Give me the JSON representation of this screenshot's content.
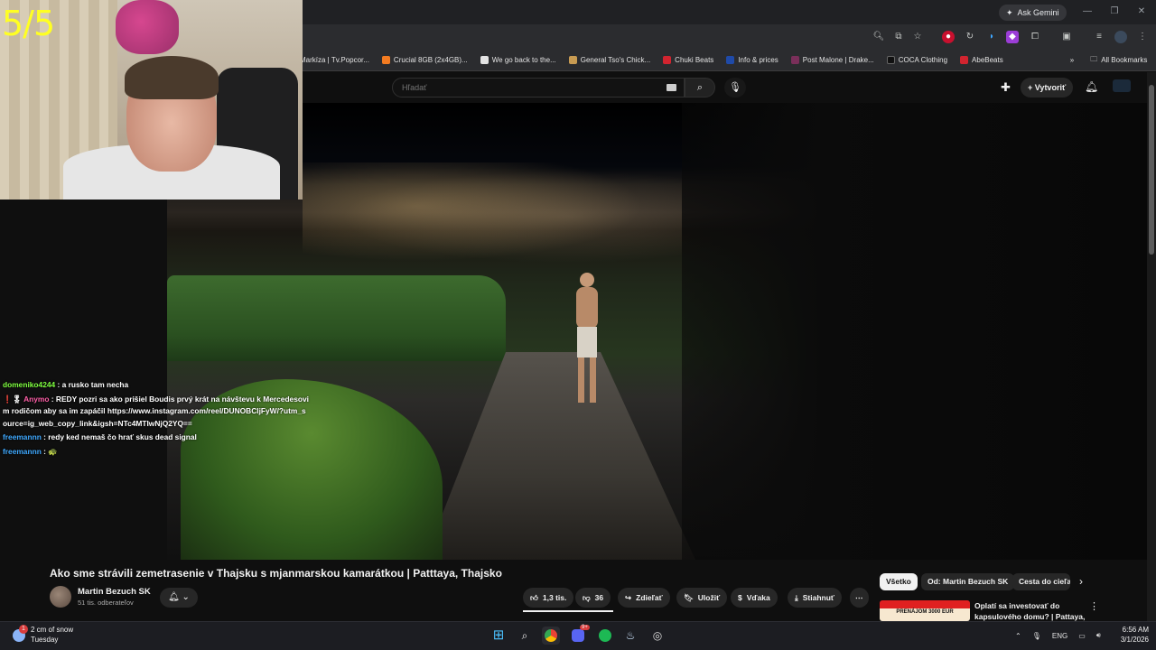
{
  "stream_overlay": {
    "counter": "5/5"
  },
  "browser": {
    "ask_gemini": "Ask Gemini",
    "bookmarks": [
      {
        "label": "Markíza | Tv.Popcor...",
        "color": "#2a6fdb"
      },
      {
        "label": "Crucial 8GB (2x4GB)...",
        "color": "#f27b21"
      },
      {
        "label": "We go back to the...",
        "color": "#e3e3e3"
      },
      {
        "label": "General Tso's Chick...",
        "color": "#c89b52"
      },
      {
        "label": "Chuki Beats",
        "color": "#d1242f"
      },
      {
        "label": "Info & prices",
        "color": "#1f4aa8"
      },
      {
        "label": "Post Malone | Drake...",
        "color": "#7a2f5a"
      },
      {
        "label": "COCA Clothing",
        "color": "#111111"
      },
      {
        "label": "AbeBeats",
        "color": "#d1242f"
      }
    ],
    "all_bookmarks": "All Bookmarks"
  },
  "youtube": {
    "search_placeholder": "Hľadať",
    "create_label": "Vytvoriť",
    "video_title": "Ako sme strávili zemetrasenie v Thajsku s mjanmarskou kamarátkou | Patttaya, Thajsko",
    "channel_name": "Martin Bezuch SK",
    "subscribers": "51 tis. odberateľov",
    "actions": {
      "likes": "1,3 tis.",
      "dislikes": "36",
      "share": "Zdieľať",
      "save": "Uložiť",
      "thanks": "Vďaka",
      "download": "Stiahnuť"
    },
    "chips": [
      "Všetko",
      "Od: Martin Bezuch SK",
      "Cesta do cieľa"
    ],
    "recommendation": {
      "title": "Oplatí sa investovať do kapsulového domu? | Pattaya, ...",
      "thumb_text": "PRENÁJOM 3000 EUR"
    }
  },
  "chat": [
    {
      "user": "domeniko4244",
      "user_color": "#7fff3f",
      "message": "a rusko tam necha"
    },
    {
      "user": "Anymo",
      "user_color": "#ff5fa8",
      "badges": "❗🎖",
      "message": "REDY pozri sa ako prišiel Boudis prvý krát na návštevu k Mercedesovim rodičom aby sa im zapáčil https://www.instagram.com/reel/DUNOBCIjFyW/?utm_source=ig_web_copy_link&igsh=NTc4MTIwNjQ2YQ=="
    },
    {
      "user": "freemannn",
      "user_color": "#3fa9ff",
      "message": "redy ked nemaš čo hrať skus dead signal"
    },
    {
      "user": "freemannn",
      "user_color": "#3fa9ff",
      "message": "🐢"
    }
  ],
  "taskbar": {
    "weather_temp": "2 cm of snow",
    "weather_day": "Tuesday",
    "weather_badge": "1",
    "lang": "ENG",
    "time": "6:56 AM",
    "date": "3/1/2026",
    "discord_badge": "9+"
  }
}
